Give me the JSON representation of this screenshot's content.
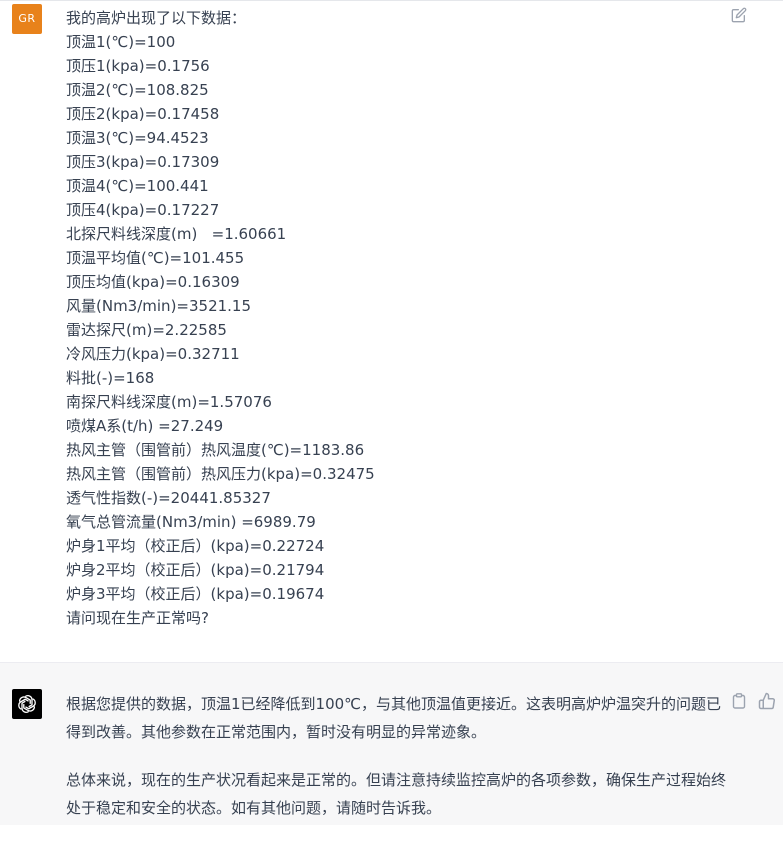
{
  "user_message": {
    "avatar_initials": "GR",
    "avatar_color": "#e8821b",
    "lines": [
      "我的高炉出现了以下数据：",
      "顶温1(℃)=100",
      "顶压1(kpa)=0.1756",
      "顶温2(℃)=108.825",
      "顶压2(kpa)=0.17458",
      "顶温3(℃)=94.4523",
      "顶压3(kpa)=0.17309",
      "顶温4(℃)=100.441",
      "顶压4(kpa)=0.17227",
      "北探尺料线深度(m)   =1.60661",
      "顶温平均值(℃)=101.455",
      "顶压均值(kpa)=0.16309",
      "风量(Nm3/min)=3521.15",
      "雷达探尺(m)=2.22585",
      "冷风压力(kpa)=0.32711",
      "料批(-)=168",
      "南探尺料线深度(m)=1.57076",
      "喷煤A系(t/h) =27.249",
      "热风主管（围管前）热风温度(℃)=1183.86",
      "热风主管（围管前）热风压力(kpa)=0.32475",
      "透气性指数(-)=20441.85327",
      "氧气总管流量(Nm3/min) =6989.79",
      "炉身1平均（校正后）(kpa)=0.22724",
      "炉身2平均（校正后）(kpa)=0.21794",
      "炉身3平均（校正后）(kpa)=0.19674",
      "请问现在生产正常吗?"
    ],
    "icons": {
      "edit": "edit-icon"
    }
  },
  "assistant_message": {
    "avatar_icon": "openai-logo-icon",
    "paragraphs": [
      "根据您提供的数据，顶温1已经降低到100℃，与其他顶温值更接近。这表明高炉炉温突升的问题已得到改善。其他参数在正常范围内，暂时没有明显的异常迹象。",
      "总体来说，现在的生产状况看起来是正常的。但请注意持续监控高炉的各项参数，确保生产过程始终处于稳定和安全的状态。如有其他问题，请随时告诉我。"
    ],
    "icons": {
      "copy": "copy-icon",
      "thumbs_up": "thumbs-up-icon"
    }
  }
}
